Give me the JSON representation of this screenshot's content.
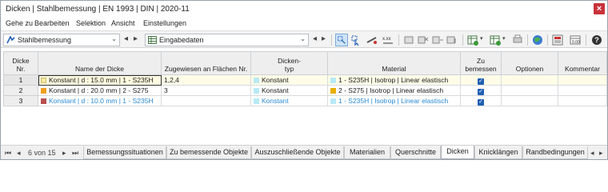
{
  "window": {
    "title": "Dicken | Stahlbemessung | EN 1993 | DIN | 2020-11",
    "close_label": "×"
  },
  "menu": [
    "Gehe zu",
    "Bearbeiten",
    "Selektion",
    "Ansicht",
    "Einstellungen"
  ],
  "toolbar": {
    "module_combo": "Stahlbemessung",
    "data_combo": "Eingabedaten",
    "icons": [
      "select-icon",
      "select-arrow-icon",
      "member-icon",
      "xxx-icon",
      "copy-icon",
      "delete-x-icon",
      "move-icon",
      "filter-icon",
      "table-export-icon",
      "table-import-icon",
      "print-icon",
      "globe-icon",
      "calculator-icon",
      "help-icon"
    ]
  },
  "table": {
    "headers": {
      "nr": "Dicke\nNr.",
      "name": "Name der Dicke",
      "assigned": "Zugewiesen an Flächen Nr.",
      "type": "Dicken-\ntyp",
      "material": "Material",
      "design": "Zu\nbemessen",
      "options": "Optionen",
      "comment": "Kommentar"
    },
    "rows": [
      {
        "nr": "1",
        "name": "Konstant | d : 15.0 mm | 1 - S235H",
        "name_color": "#f5e9a8",
        "assigned": "1,2,4",
        "type": "Konstant",
        "type_color": "#b8eaf4",
        "material": "1 - S235H | Isotrop | Linear elastisch",
        "material_color": "#b8eaf4",
        "design": "✓",
        "options": "",
        "comment": "",
        "highlight": false
      },
      {
        "nr": "2",
        "name": "Konstant | d : 20.0 mm | 2 - S275",
        "name_color": "#f0a020",
        "assigned": "3",
        "type": "Konstant",
        "type_color": "#b8eaf4",
        "material": "2 - S275 | Isotrop | Linear elastisch",
        "material_color": "#e8b000",
        "design": "✓",
        "options": "",
        "comment": "",
        "highlight": false
      },
      {
        "nr": "3",
        "name": "Konstant | d : 10.0 mm | 1 - S235H",
        "name_color": "#b85050",
        "assigned": "",
        "type": "Konstant",
        "type_color": "#b8eaf4",
        "material": "1 - S235H | Isotrop | Linear elastisch",
        "material_color": "#b8eaf4",
        "design": "✓",
        "options": "",
        "comment": "",
        "highlight": true
      }
    ]
  },
  "pager": {
    "label": "6 von 15"
  },
  "tabs": [
    "Bemessungssituationen",
    "Zu bemessende Objekte",
    "Auszuschließende Objekte",
    "Materialien",
    "Querschnitte",
    "Dicken",
    "Knicklängen",
    "Randbedingungen"
  ],
  "active_tab": "Dicken"
}
